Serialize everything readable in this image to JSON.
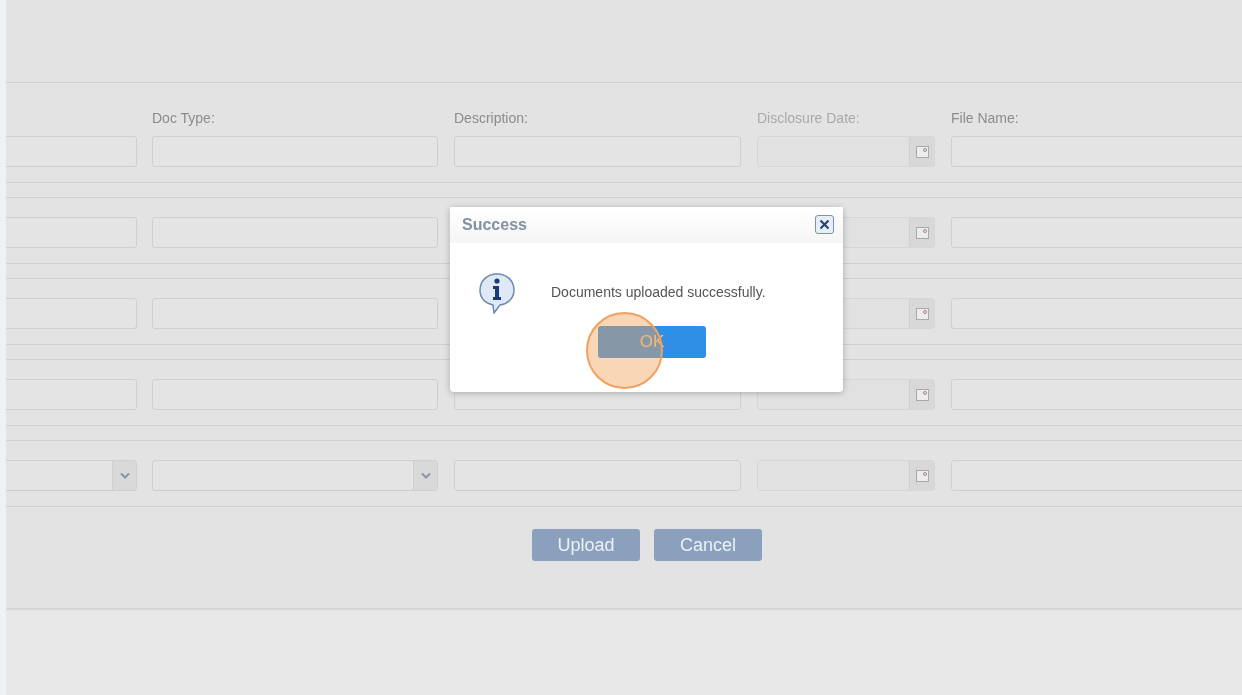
{
  "form": {
    "columns": [
      {
        "label": "Doc Type:",
        "disabled": false
      },
      {
        "label": "Description:",
        "disabled": false
      },
      {
        "label": "Disclosure Date:",
        "disabled": true
      },
      {
        "label": "File Name:",
        "disabled": false
      }
    ],
    "rows": [
      {
        "cells": [
          {
            "kind": "text"
          },
          {
            "kind": "text"
          },
          {
            "kind": "text"
          },
          {
            "kind": "date"
          },
          {
            "kind": "text"
          }
        ]
      },
      {
        "cells": [
          {
            "kind": "text"
          },
          {
            "kind": "text"
          },
          null,
          {
            "kind": "date"
          },
          {
            "kind": "text"
          }
        ]
      },
      {
        "cells": [
          {
            "kind": "text"
          },
          {
            "kind": "text"
          },
          null,
          {
            "kind": "date"
          },
          {
            "kind": "text"
          }
        ]
      },
      {
        "cells": [
          {
            "kind": "text"
          },
          {
            "kind": "text"
          },
          {
            "kind": "text"
          },
          {
            "kind": "date"
          },
          {
            "kind": "text"
          }
        ]
      },
      {
        "cells": [
          {
            "kind": "select"
          },
          {
            "kind": "select"
          },
          {
            "kind": "text"
          },
          {
            "kind": "date"
          },
          {
            "kind": "text"
          }
        ]
      }
    ],
    "buttons": [
      "Upload",
      "Cancel"
    ]
  },
  "dialog": {
    "title": "Success",
    "message": "Documents uploaded successfully.",
    "ok_button": "OK"
  }
}
